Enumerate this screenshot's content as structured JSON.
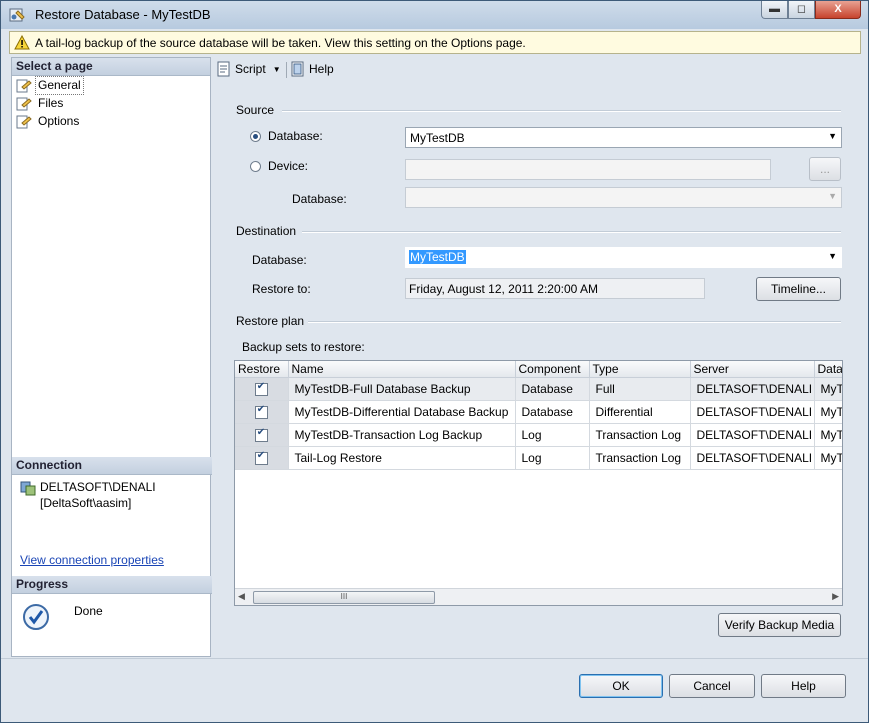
{
  "window": {
    "title": "Restore Database - MyTestDB",
    "close_glyph": "X",
    "min_glyph": "▬",
    "max_glyph": "◻"
  },
  "infobar": {
    "message": "A tail-log backup of the source database will be taken. View this setting on the Options page."
  },
  "left": {
    "select_page_header": "Select a page",
    "pages": [
      {
        "label": "General",
        "icon": "page-icon"
      },
      {
        "label": "Files",
        "icon": "page-icon"
      },
      {
        "label": "Options",
        "icon": "page-icon"
      }
    ],
    "connection_header": "Connection",
    "server": "DELTASOFT\\DENALI",
    "user": "[DeltaSoft\\aasim]",
    "view_connection": "View connection properties",
    "progress_header": "Progress",
    "progress_status": "Done"
  },
  "toolbar": {
    "script_label": "Script",
    "help_label": "Help"
  },
  "source": {
    "group_label": "Source",
    "database_radio_label": "Database:",
    "database_value": "MyTestDB",
    "device_radio_label": "Device:",
    "device_browse": "...",
    "device_database_label": "Database:"
  },
  "destination": {
    "group_label": "Destination",
    "database_label": "Database:",
    "database_value": "MyTestDB",
    "restore_to_label": "Restore to:",
    "restore_to_value": "Friday, August 12, 2011 2:20:00 AM",
    "timeline_button": "Timeline..."
  },
  "restore_plan": {
    "group_label": "Restore plan",
    "backup_sets_label": "Backup sets to restore:",
    "columns": [
      "Restore",
      "Name",
      "Component",
      "Type",
      "Server",
      "Datal"
    ],
    "rows": [
      {
        "name": "MyTestDB-Full Database Backup",
        "component": "Database",
        "type": "Full",
        "server": "DELTASOFT\\DENALI",
        "database": "MyT"
      },
      {
        "name": "MyTestDB-Differential Database Backup",
        "component": "Database",
        "type": "Differential",
        "server": "DELTASOFT\\DENALI",
        "database": "MyT"
      },
      {
        "name": "MyTestDB-Transaction Log  Backup",
        "component": "Log",
        "type": "Transaction Log",
        "server": "DELTASOFT\\DENALI",
        "database": "MyT"
      },
      {
        "name": "Tail-Log Restore",
        "component": "Log",
        "type": "Transaction Log",
        "server": "DELTASOFT\\DENALI",
        "database": "MyT"
      }
    ],
    "scroll_thumb_glyph": "III",
    "verify_button": "Verify Backup Media"
  },
  "footer": {
    "ok": "OK",
    "cancel": "Cancel",
    "help": "Help"
  }
}
